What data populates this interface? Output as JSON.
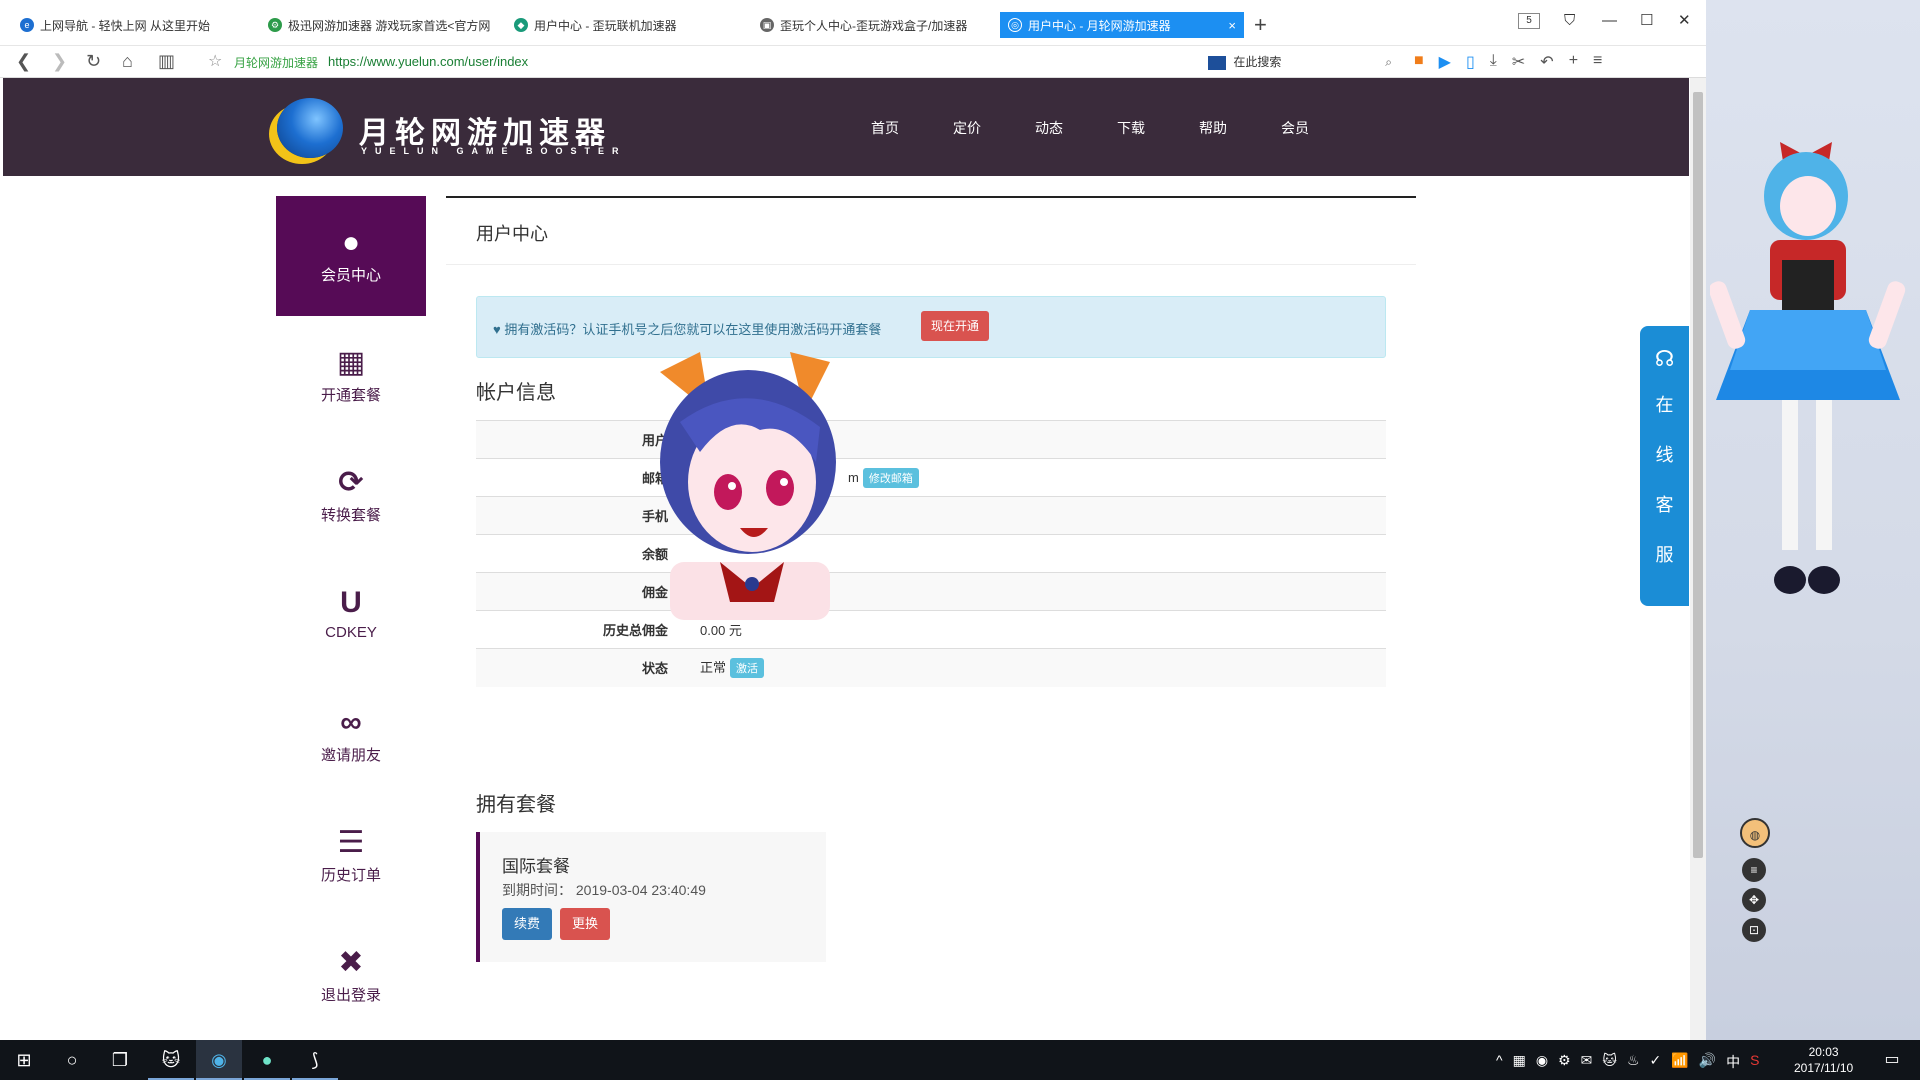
{
  "browser": {
    "tabs": [
      {
        "title": "上网导航 - 轻快上网 从这里开始",
        "color": "#1d6fd1",
        "glyph": "e"
      },
      {
        "title": "极迅网游加速器 游戏玩家首选<官方网",
        "color": "#2d9b4a",
        "glyph": "⚙"
      },
      {
        "title": "用户中心 - 歪玩联机加速器",
        "color": "#1a9a7a",
        "glyph": "◆"
      },
      {
        "title": "歪玩个人中心-歪玩游戏盒子/加速器",
        "color": "#666666",
        "glyph": "▣"
      }
    ],
    "active_tab": {
      "title": "用户中心 - 月轮网游加速器",
      "close": "×"
    },
    "new_tab": "+",
    "tab_count": "5",
    "window_controls": [
      "⛉",
      "—",
      "☐",
      "✕"
    ],
    "nav": {
      "back": "❮",
      "forward": "❯",
      "reload": "↻",
      "home": "⌂",
      "reader": "▥"
    },
    "bookmark_star": "☆",
    "site_name": "月轮网游加速器",
    "url": "https://www.yuelun.com/user/index",
    "search_placeholder": "在此搜索",
    "toolbar_icons": [
      "search-icon",
      "camera-icon",
      "play-icon",
      "phone-icon",
      "download-icon",
      "scissors-icon",
      "undo-icon",
      "plus-icon",
      "menu-icon"
    ]
  },
  "site": {
    "logo_text": "月轮网游加速器",
    "logo_sub": "YUELUN GAME BOOSTER",
    "nav": [
      "首页",
      "定价",
      "动态",
      "下载",
      "帮助",
      "会员"
    ]
  },
  "sidebar": {
    "items": [
      {
        "label": "会员中心",
        "icon": "user-icon",
        "glyph": "👤",
        "active": true
      },
      {
        "label": "开通套餐",
        "icon": "gift-icon",
        "glyph": "🎁",
        "active": false
      },
      {
        "label": "转换套餐",
        "icon": "refresh-icon",
        "glyph": "⟳",
        "active": false
      },
      {
        "label": "CDKEY",
        "icon": "magnet-icon",
        "glyph": "U",
        "active": false
      },
      {
        "label": "邀请朋友",
        "icon": "link-icon",
        "glyph": "🔗",
        "active": false
      },
      {
        "label": "历史订单",
        "icon": "list-icon",
        "glyph": "☰",
        "active": false
      },
      {
        "label": "退出登录",
        "icon": "close-icon",
        "glyph": "✖",
        "active": false
      }
    ]
  },
  "main": {
    "title": "用户中心",
    "alert": {
      "text": "♥ 拥有激活码？认证手机号之后您就可以在这里使用激活码开通套餐",
      "button": "现在开通"
    },
    "account_title": "帐户信息",
    "account_rows": [
      {
        "key": "用户",
        "value": "",
        "badge": ""
      },
      {
        "key": "邮箱",
        "value": "m",
        "badge": "修改邮箱"
      },
      {
        "key": "手机",
        "value": "",
        "badge": ""
      },
      {
        "key": "余额",
        "value": "",
        "badge": ""
      },
      {
        "key": "佣金",
        "value": "",
        "badge": ""
      },
      {
        "key": "历史总佣金",
        "value": "0.00 元",
        "badge": ""
      },
      {
        "key": "状态",
        "value": "正常",
        "badge": "激活"
      }
    ],
    "packages_title": "拥有套餐",
    "package": {
      "name": "国际套餐",
      "expiry_label": "到期时间：",
      "expiry": "2019-03-04 23:40:49",
      "renew": "续费",
      "change": "更换"
    }
  },
  "service": {
    "text": "在线客服"
  },
  "desktop_controls": [
    "◍",
    "≡",
    "✥",
    "⊡"
  ],
  "taskbar": {
    "tray_icons": [
      "^",
      "▦",
      "◉",
      "⚙",
      "✉",
      "🐱",
      "♨",
      "✓",
      "📶",
      "🔊"
    ],
    "ime": "中",
    "time": "20:03",
    "date": "2017/11/10"
  },
  "colors": {
    "header_bg": "#3a2b3b",
    "sidebar_active": "#560b56",
    "accent_blue": "#1c8ff2",
    "danger": "#d9534f",
    "info": "#5bc0de"
  }
}
